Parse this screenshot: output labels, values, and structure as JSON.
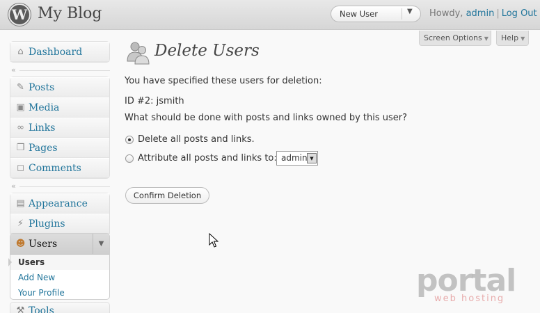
{
  "header": {
    "site_title": "My Blog",
    "favorite_action": "New User",
    "howdy_prefix": "Howdy,",
    "user": "admin",
    "logout": "Log Out"
  },
  "screen_meta": {
    "screen_options": "Screen Options",
    "help": "Help"
  },
  "menu": {
    "dashboard": "Dashboard",
    "posts": "Posts",
    "media": "Media",
    "links": "Links",
    "pages": "Pages",
    "comments": "Comments",
    "appearance": "Appearance",
    "plugins": "Plugins",
    "users": "Users",
    "users_sub": [
      "Users",
      "Add New",
      "Your Profile"
    ],
    "tools": "Tools"
  },
  "main": {
    "title": "Delete Users",
    "intro": "You have specified these users for deletion:",
    "user_line": "ID #2: jsmith",
    "question": "What should be done with posts and links owned by this user?",
    "option_delete": "Delete all posts and links.",
    "option_attribute": "Attribute all posts and links to:",
    "attribute_selected": "admin",
    "confirm_button": "Confirm Deletion"
  },
  "watermark": {
    "brand": "portal",
    "tagline": "web hosting"
  },
  "colors": {
    "link": "#21759b",
    "header_bg": "#dcdcdc",
    "body_bg": "#f9f9f9"
  }
}
